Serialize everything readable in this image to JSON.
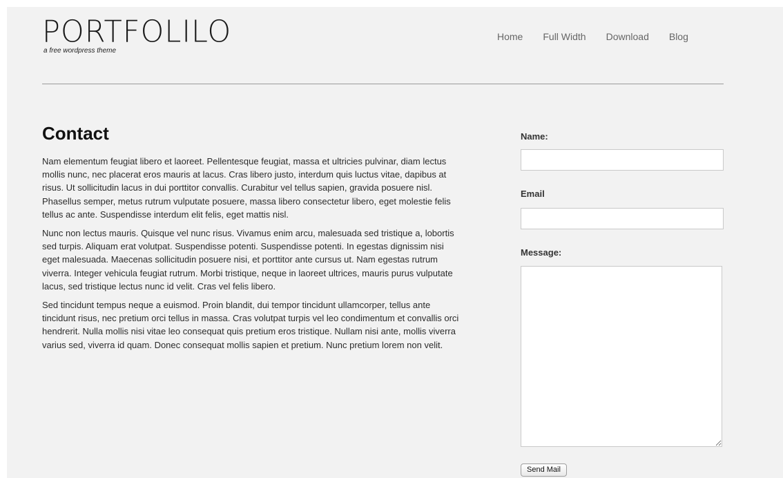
{
  "header": {
    "logo": "PORTFOLILO",
    "tagline": "a free wordpress theme",
    "nav": [
      "Home",
      "Full Width",
      "Download",
      "Blog"
    ]
  },
  "content": {
    "title": "Contact",
    "paragraphs": [
      "Nam elementum feugiat libero et laoreet. Pellentesque feugiat, massa et ultricies pulvinar, diam lectus mollis nunc, nec placerat eros mauris at lacus. Cras libero justo, interdum quis luctus vitae, dapibus at risus. Ut sollicitudin lacus in dui porttitor convallis. Curabitur vel tellus sapien, gravida posuere nisl. Phasellus semper, metus rutrum vulputate posuere, massa libero consectetur libero, eget molestie felis tellus ac ante. Suspendisse interdum elit felis, eget mattis nisl.",
      "Nunc non lectus mauris. Quisque vel nunc risus. Vivamus enim arcu, malesuada sed tristique a, lobortis sed turpis. Aliquam erat volutpat. Suspendisse potenti. Suspendisse potenti. In egestas dignissim nisi eget malesuada. Maecenas sollicitudin posuere nisi, et porttitor ante cursus ut. Nam egestas rutrum viverra. Integer vehicula feugiat rutrum. Morbi tristique, neque in laoreet ultrices, mauris purus vulputate lacus, sed tristique lectus nunc id velit. Cras vel felis libero.",
      "Sed tincidunt tempus neque a euismod. Proin blandit, dui tempor tincidunt ullamcorper, tellus ante tincidunt risus, nec pretium orci tellus in massa. Cras volutpat turpis vel leo condimentum et convallis orci hendrerit. Nulla mollis nisi vitae leo consequat quis pretium eros tristique. Nullam nisi ante, mollis viverra varius sed, viverra id quam. Donec consequat mollis sapien et pretium. Nunc pretium lorem non velit."
    ]
  },
  "form": {
    "name_label": "Name:",
    "name_value": "",
    "email_label": "Email",
    "email_value": "",
    "message_label": "Message:",
    "message_value": "",
    "submit_label": "Send Mail"
  }
}
